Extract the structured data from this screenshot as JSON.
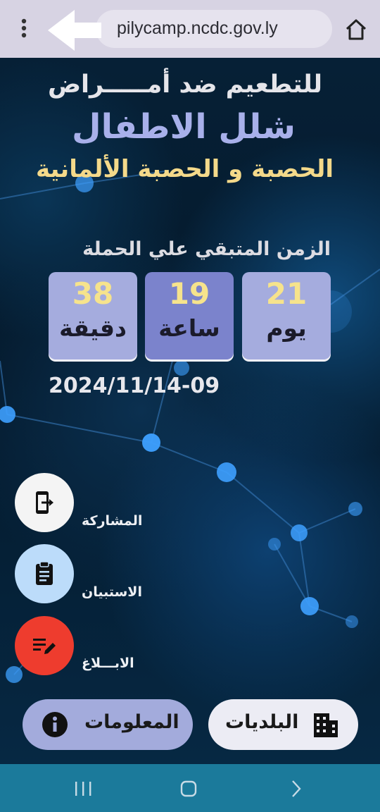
{
  "browser": {
    "url": "pilycamp.ncdc.gov.ly",
    "menu_icon": "more-vert-icon",
    "back_icon": "arrow-left-icon",
    "home_icon": "home-icon"
  },
  "hero": {
    "title_line1": "للتطعيم ضد أمـــــراض",
    "title_line2": "شلل الاطفال",
    "title_line3": "الحصبة و الحصبة الألمانية",
    "countdown_label": "الزمن المتبقي علي الحملة",
    "countdown": {
      "days_value": "21",
      "days_unit": "يوم",
      "hours_value": "19",
      "hours_unit": "ساعة",
      "minutes_value": "38",
      "minutes_unit": "دقيقة"
    },
    "campaign_date": "2024/11/14-09"
  },
  "actions": [
    {
      "label": "المشاركة",
      "icon": "exit-to-app-icon"
    },
    {
      "label": "الاستبيان",
      "icon": "clipboard-icon"
    },
    {
      "label": "الابـــلاغ",
      "icon": "edit-note-icon"
    }
  ],
  "bottom_buttons": {
    "info_label": "المعلومات",
    "info_icon": "info-icon",
    "municipalities_label": "البلديات",
    "municipalities_icon": "apartment-icon"
  },
  "system_nav": {
    "recents_icon": "recents-icon",
    "home_icon": "home-circle-icon",
    "back_icon": "chevron-back-icon"
  },
  "colors": {
    "title_primary": "#a8b0ea",
    "title_secondary": "#f4d98a",
    "countdown_box": "#a5acde",
    "countdown_box_active": "#7b83cc",
    "report_button": "#ee3c2e",
    "survey_button": "#bcdcfa",
    "nav_bar": "#1b7a9b"
  }
}
